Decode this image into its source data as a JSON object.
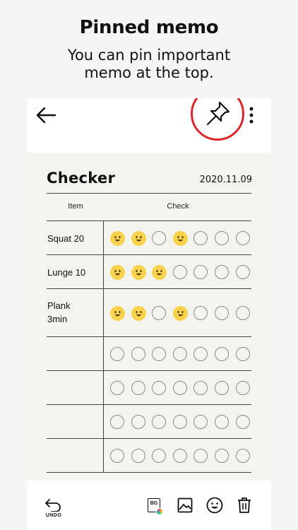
{
  "promo": {
    "title": "Pinned memo",
    "subtitle_line1": "You can pin important",
    "subtitle_line2": "memo at the top."
  },
  "colors": {
    "pin_highlight": "#e1252c",
    "memo_background": "#f4f4ef",
    "smile_face": "#f9d34c"
  },
  "appbar": {
    "back_icon": "arrow-left-icon",
    "pin_icon": "pushpin-icon",
    "more_icon": "more-vertical-icon"
  },
  "memo": {
    "title": "Checker",
    "date": "2020.11.09",
    "columns": [
      "Item",
      "Check"
    ],
    "rows": [
      {
        "item_line1": "Squat 20",
        "item_line2": "",
        "checks": [
          1,
          1,
          0,
          1,
          0,
          0,
          0
        ]
      },
      {
        "item_line1": "Lunge 10",
        "item_line2": "",
        "checks": [
          1,
          1,
          1,
          0,
          0,
          0,
          0
        ]
      },
      {
        "item_line1": "Plank",
        "item_line2": "3min",
        "checks": [
          1,
          1,
          0,
          1,
          0,
          0,
          0
        ]
      },
      {
        "item_line1": "",
        "item_line2": "",
        "checks": [
          0,
          0,
          0,
          0,
          0,
          0,
          0
        ]
      },
      {
        "item_line1": "",
        "item_line2": "",
        "checks": [
          0,
          0,
          0,
          0,
          0,
          0,
          0
        ]
      },
      {
        "item_line1": "",
        "item_line2": "",
        "checks": [
          0,
          0,
          0,
          0,
          0,
          0,
          0
        ]
      },
      {
        "item_line1": "",
        "item_line2": "",
        "checks": [
          0,
          0,
          0,
          0,
          0,
          0,
          0
        ]
      }
    ]
  },
  "bottombar": {
    "undo_label": "UNDO",
    "bg_label": "BG",
    "icons": [
      "undo-icon",
      "background-color-icon",
      "image-icon",
      "emoji-icon",
      "trash-icon"
    ]
  }
}
